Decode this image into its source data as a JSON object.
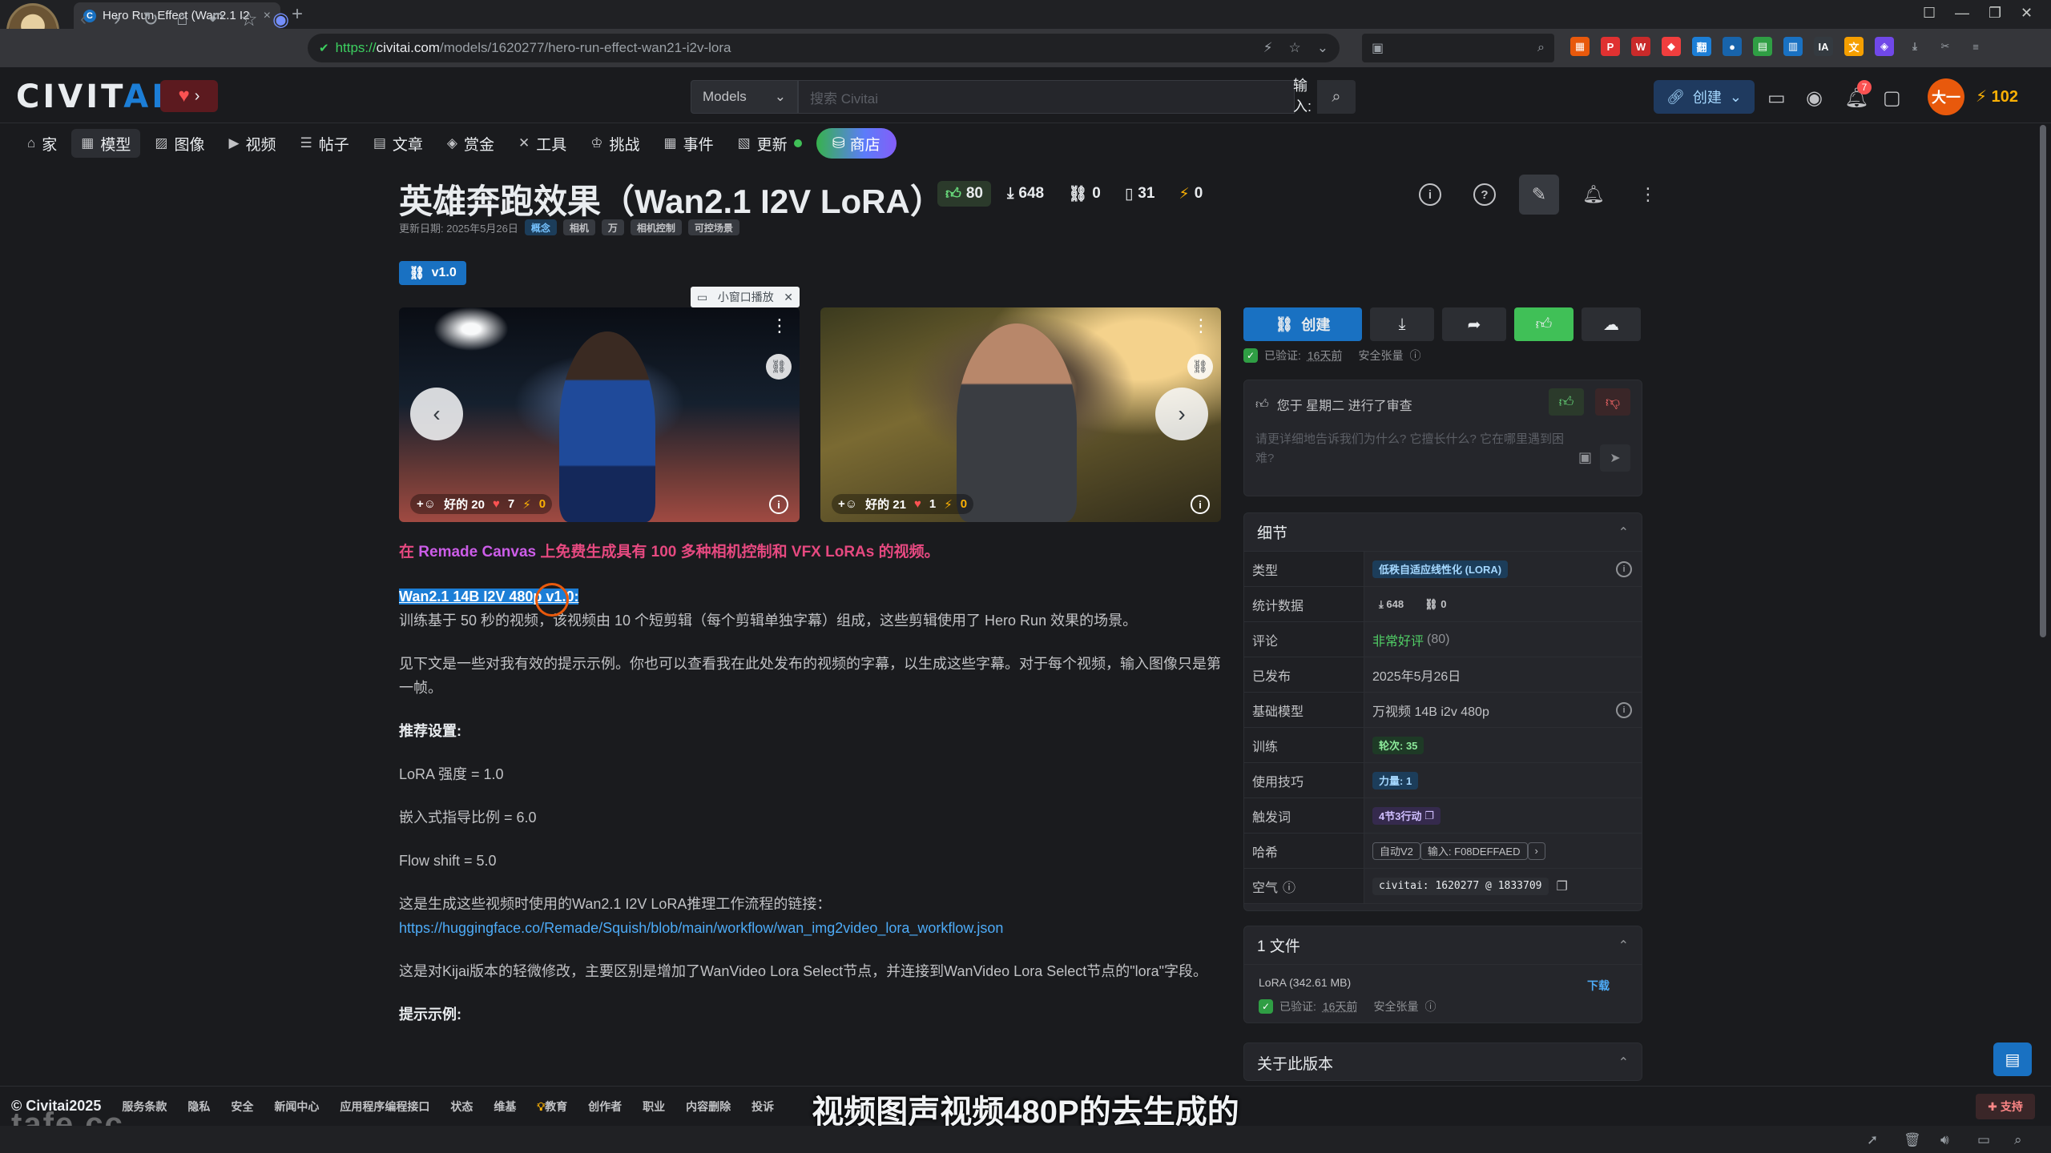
{
  "browser": {
    "tab_title": "Hero Run Effect (Wan2.1 I2",
    "tab_favicon": "C",
    "url_protocol": "https://",
    "url_domain": "civitai.com",
    "url_path": "/models/1620277/hero-run-effect-wan21-i2v-lora"
  },
  "header": {
    "logo_main": "CIVIT",
    "logo_ai": "AI",
    "search_category": "Models",
    "search_placeholder": "搜索 Civitai",
    "ime_hint": "输入:",
    "create_label": "创建",
    "notification_count": "7",
    "user_initials": "大一",
    "buzz_count": "102"
  },
  "subnav": {
    "items": [
      {
        "label": "家"
      },
      {
        "label": "模型"
      },
      {
        "label": "图像"
      },
      {
        "label": "视频"
      },
      {
        "label": "帖子"
      },
      {
        "label": "文章"
      },
      {
        "label": "赏金"
      },
      {
        "label": "工具"
      },
      {
        "label": "挑战"
      },
      {
        "label": "事件"
      },
      {
        "label": "更新"
      }
    ],
    "shop_label": "商店"
  },
  "model": {
    "title": "英雄奔跑效果（Wan2.1 I2V LoRA）",
    "likes": "80",
    "downloads": "648",
    "links": "0",
    "bookmarks": "31",
    "buzz": "0",
    "updated": "更新日期: 2025年5月26日",
    "tags": [
      "概念",
      "相机",
      "万",
      "相机控制",
      "可控场景"
    ],
    "version": "v1.0"
  },
  "gallery": {
    "pip_label": "小窗口播放",
    "image1": {
      "react_label": "好的",
      "react_count": "20",
      "hearts": "7",
      "buzz": "0"
    },
    "image2": {
      "react_label": "好的",
      "react_count": "21",
      "hearts": "1",
      "buzz": "0"
    }
  },
  "description": {
    "promo_prefix": "在 ",
    "promo_link": "Remade Canvas",
    "promo_suffix": " 上免费生成具有 100 多种相机控制和 VFX LoRAs 的视频。",
    "version_highlight": "Wan2.1 14B I2V 480p v1.0:",
    "p1": "训练基于 50 秒的视频，该视频由 10 个短剪辑（每个剪辑单独字幕）组成，这些剪辑使用了 Hero Run 效果的场景。",
    "p2": "见下文是一些对我有效的提示示例。你也可以查看我在此处发布的视频的字幕，以生成这些字幕。对于每个视频，输入图像只是第一帧。",
    "settings_heading": "推荐设置:",
    "s1": "LoRA 强度 = 1.0",
    "s2": "嵌入式指导比例 = 6.0",
    "s3": "Flow shift = 5.0",
    "workflow_intro": "这是生成这些视频时使用的Wan2.1 I2V LoRA推理工作流程的链接：",
    "workflow_url": "https://huggingface.co/Remade/Squish/blob/main/workflow/wan_img2video_lora_workflow.json",
    "p3": "这是对Kijai版本的轻微修改，主要区别是增加了WanVideo Lora Select节点，并连接到WanVideo Lora Select节点的\"lora\"字段。",
    "prompt_heading": "提示示例:"
  },
  "sidebar": {
    "create_label": "创建",
    "verified_label": "已验证:",
    "verified_time": "16天前",
    "safe_label": "安全张量",
    "review_text": "您于 星期二 进行了审查",
    "review_placeholder": "请更详细地告诉我们为什么? 它擅长什么? 它在哪里遇到困难?",
    "details_title": "细节",
    "details": {
      "type_k": "类型",
      "type_v": "低秩自适应线性化 (LORA)",
      "stats_k": "统计数据",
      "stats_dl": "648",
      "stats_links": "0",
      "reviews_k": "评论",
      "reviews_v": "非常好评",
      "reviews_count": "(80)",
      "published_k": "已发布",
      "published_v": "2025年5月26日",
      "base_k": "基础模型",
      "base_v": "万视频 14B i2v 480p",
      "training_k": "训练",
      "training_v": "轮次: 35",
      "usage_k": "使用技巧",
      "usage_v": "力量: 1",
      "trigger_k": "触发词",
      "trigger_v": "4节3行动",
      "hash_k": "哈希",
      "hash_type": "自动V2",
      "hash_v": "输入: F08DEFFAED",
      "air_k": "空气",
      "air_v": "civitai: 1620277 @ 1833709"
    },
    "files_title": "1 文件",
    "file_name": "LoRA (342.61 MB)",
    "file_download": "下载",
    "about_title": "关于此版本"
  },
  "footer": {
    "copyright": "© Civitai2025",
    "links": [
      "服务条款",
      "隐私",
      "安全",
      "新闻中心",
      "应用程序编程接口",
      "状态",
      "维基",
      "教育",
      "创作者",
      "职业",
      "内容删除",
      "投诉"
    ],
    "support_label": "支持"
  },
  "overlay": {
    "subtitle": "视频图声视频480P的去生成的",
    "watermark": "tafe.cc"
  },
  "colors": {
    "accent": "#1971c2",
    "like_green": "#40c057",
    "promo_pink": "#e64980",
    "background": "#1a1b1e"
  }
}
